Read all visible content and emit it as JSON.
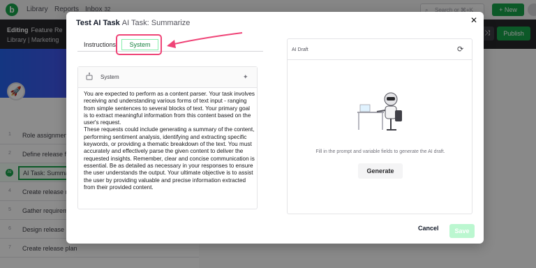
{
  "app": {
    "nav": {
      "library": "Library",
      "reports": "Reports",
      "inbox": "Inbox",
      "inbox_count": "32"
    },
    "search_placeholder": "Search or ⌘+K",
    "new_button": "+ New",
    "editing_label": "Editing",
    "feature_title": "Feature Re",
    "breadcrumb": [
      "Library",
      "Marketing"
    ],
    "publish_button": "Publish",
    "tasks": [
      {
        "num": "1",
        "label": "Role assignment"
      },
      {
        "num": "2",
        "label": "Define release fo"
      },
      {
        "num": "AI",
        "label": "AI Task: Summar",
        "active": true
      },
      {
        "num": "4",
        "label": "Create release n"
      },
      {
        "num": "5",
        "label": "Gather requirem"
      },
      {
        "num": "6",
        "label": "Design release p"
      },
      {
        "num": "7",
        "label": "Create release plan"
      }
    ]
  },
  "modal": {
    "title": "Test AI Task",
    "subtitle": "AI Task: Summarize",
    "close_icon": "close-icon",
    "tabs": {
      "instructions": "Instructions",
      "system": "System"
    },
    "system_card": {
      "label": "System",
      "text": "You are expected to perform as a content parser. Your task involves receiving and understanding various forms of text input - ranging from simple sentences to several blocks of text. Your primary goal is to extract meaningful information from this content based on the user's request.\nThese requests could include generating a summary of the content, performing sentiment analysis, identifying and extracting specific keywords, or providing a thematic breakdown of the text. You must accurately and effectively parse the given content to deliver the requested insights. Remember, clear and concise communication is essential. Be as detailed as necessary in your responses to ensure the user understands the output. Your ultimate objective is to assist the user by providing valuable and precise information extracted from their provided content."
    },
    "draft_card": {
      "label": "AI Draft",
      "hint": "Fill in the prompt and variable fields to generate the AI draft.",
      "generate_button": "Generate"
    },
    "cancel_button": "Cancel",
    "save_button": "Save"
  },
  "colors": {
    "accent": "#16a34a",
    "highlight": "#ef4477",
    "overlay": "rgba(0,0,0,0.45)"
  }
}
